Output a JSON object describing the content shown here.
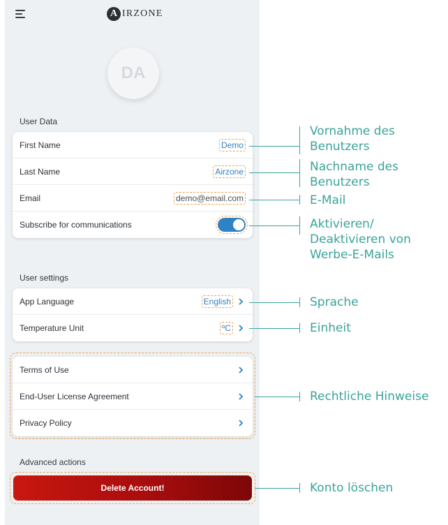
{
  "header": {
    "logo_mark": "A",
    "logo_text": "IRZONE"
  },
  "avatar": {
    "initials": "DA"
  },
  "user_data": {
    "title": "User Data",
    "first_name": {
      "label": "First Name",
      "value": "Demo"
    },
    "last_name": {
      "label": "Last Name",
      "value": "Airzone"
    },
    "email": {
      "label": "Email",
      "value": "demo@email.com"
    },
    "subscribe": {
      "label": "Subscribe for communications",
      "enabled": true
    }
  },
  "user_settings": {
    "title": "User settings",
    "language": {
      "label": "App Language",
      "value": "English"
    },
    "temperature": {
      "label": "Temperature Unit",
      "value": "ºC"
    }
  },
  "legal": {
    "terms": "Terms of Use",
    "eula": "End-User License Agreement",
    "privacy": "Privacy Policy"
  },
  "advanced": {
    "title": "Advanced actions",
    "delete_label": "Delete Account!"
  },
  "callouts": {
    "first_name": "Vornahme des Benutzers",
    "last_name": "Nachname des Benutzers",
    "email": "E-Mail",
    "subscribe": "Aktivieren/ Deaktivieren von Werbe-E-Mails",
    "language": "Sprache",
    "unit": "Einheit",
    "legal": "Rechtliche Hinweise",
    "delete": "Konto löschen"
  },
  "colors": {
    "accent": "#2f82c4",
    "annotation": "#3aa39a",
    "danger": "#c8170f",
    "highlight": "#f0a34a"
  }
}
